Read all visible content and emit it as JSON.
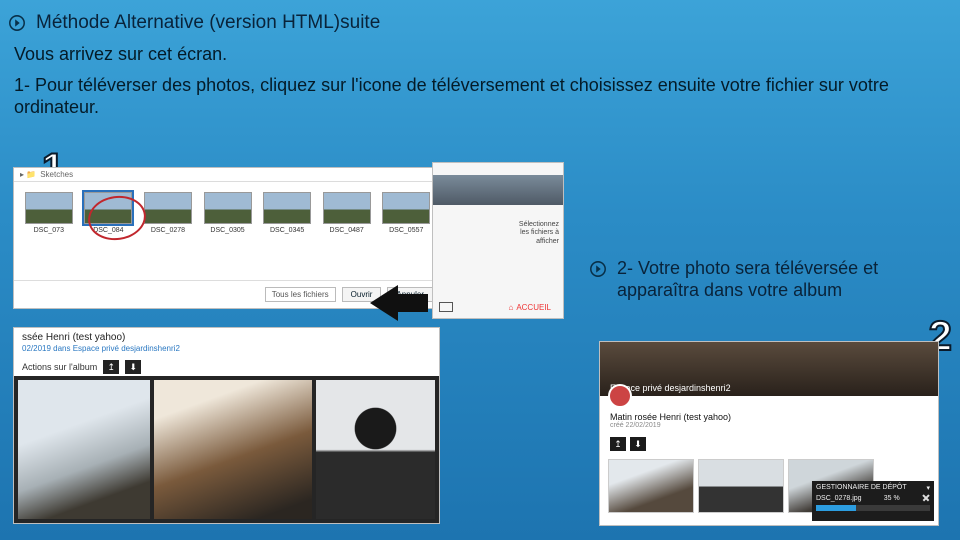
{
  "title": "Méthode Alternative (version HTML)suite",
  "intro": "Vous arrivez sur cet écran.",
  "step1_text": "1- Pour téléverser des photos, cliquez sur l'icone de téléversement et choisissez ensuite votre fichier sur votre ordinateur.",
  "step2_text": "2- Votre photo sera téléversée et apparaîtra dans votre album",
  "callout1": "1",
  "callout2": "2",
  "file_dialog": {
    "folder_label": "Sketches",
    "thumbs": [
      "DSC_073",
      "DSC_084",
      "DSC_0278",
      "DSC_0305",
      "DSC_0345",
      "DSC_0487",
      "DSC_0557"
    ],
    "selected_index": 1,
    "filter_label": "Tous les fichiers",
    "open_label": "Ouvrir",
    "cancel_label": "Annuler"
  },
  "side_panel": {
    "hint1": "Sélectionnez",
    "hint2": "les fichiers à",
    "hint3": "afficher",
    "home_label": "ACCUEIL"
  },
  "album1": {
    "title": "ssée Henri (test yahoo)",
    "subtitle_prefix": "02/2019 dans ",
    "subtitle_link": "Espace privé desjardinshenri2",
    "actions_label": "Actions sur l'album"
  },
  "album2": {
    "banner_overlay": "Espace privé desjardinshenri2",
    "title": "Matin rosée Henri (test yahoo)",
    "subtitle": "créé 22/02/2019"
  },
  "uploader": {
    "header": "GESTIONNAIRE DE DÉPÔT",
    "filename": "DSC_0278.jpg",
    "percent": "35 %"
  }
}
